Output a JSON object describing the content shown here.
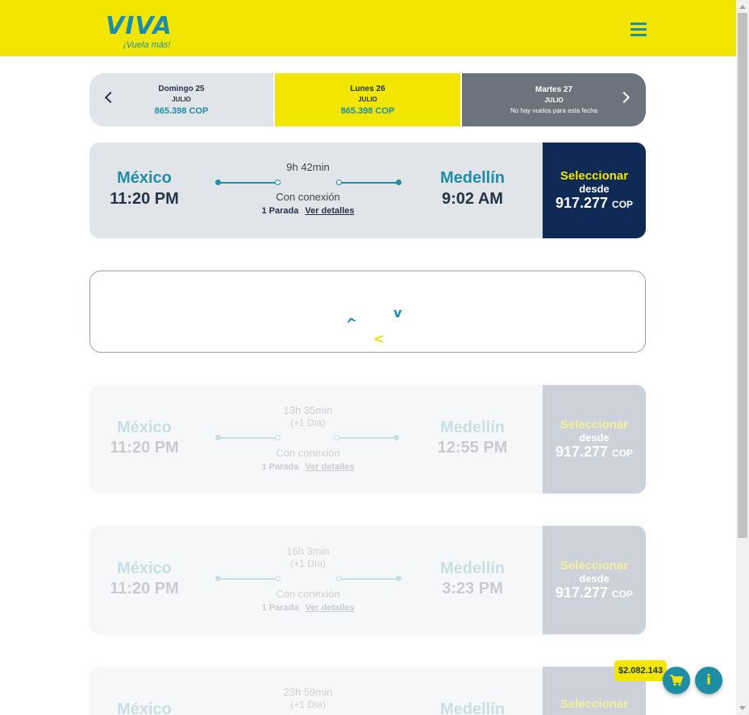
{
  "header": {
    "logo_text": "VIVA",
    "tagline": "¡Vuela más!",
    "menu_icon": "hamburger-menu-icon",
    "colors": {
      "brand_yellow": "#f2e600",
      "brand_teal": "#1d8ea6",
      "navy": "#0f2b55"
    }
  },
  "date_selector": {
    "days": [
      {
        "day": "Domingo 25",
        "month": "JULIO",
        "price": "865.398 COP"
      },
      {
        "day": "Lunes 26",
        "month": "JULIO",
        "price": "865.398 COP"
      },
      {
        "day": "Martes 27",
        "month": "JULIO",
        "note": "No hay vuelos para esta fecha"
      }
    ]
  },
  "flights": [
    {
      "origin": "México",
      "origin_time": "11:20 PM",
      "destination": "Medellín",
      "destination_time": "9:02 AM",
      "duration": "9h 42min",
      "connection": "Con conexión",
      "stops": "1 Parada",
      "details": "Ver detalles",
      "select": "Seleccionar",
      "from": "desde",
      "price": "917.277",
      "currency": "COP"
    },
    {
      "origin": "México",
      "origin_time": "11:20 PM",
      "destination": "Medellín",
      "destination_time": "12:55 PM",
      "duration": "13h 35min",
      "day_offset": "(+1 Día)",
      "connection": "Con conexión",
      "stops": "1 Parada",
      "details": "Ver detalles",
      "select": "Seleccionar",
      "from": "desde",
      "price": "917.277",
      "currency": "COP"
    },
    {
      "origin": "México",
      "origin_time": "11:20 PM",
      "destination": "Medellín",
      "destination_time": "3:23 PM",
      "duration": "16h 3min",
      "day_offset": "(+1 Día)",
      "connection": "Con conexión",
      "stops": "1 Parada",
      "details": "Ver detalles",
      "select": "Seleccionar",
      "from": "desde",
      "price": "917.277",
      "currency": "COP"
    },
    {
      "origin": "México",
      "destination": "Medellín",
      "duration": "23h 59min",
      "day_offset": "(+1 Día)",
      "select": "Seleccionar"
    }
  ],
  "cart": {
    "total": "$2.082.143",
    "cart_icon": "shopping-cart-icon",
    "info_icon": "info-icon"
  }
}
